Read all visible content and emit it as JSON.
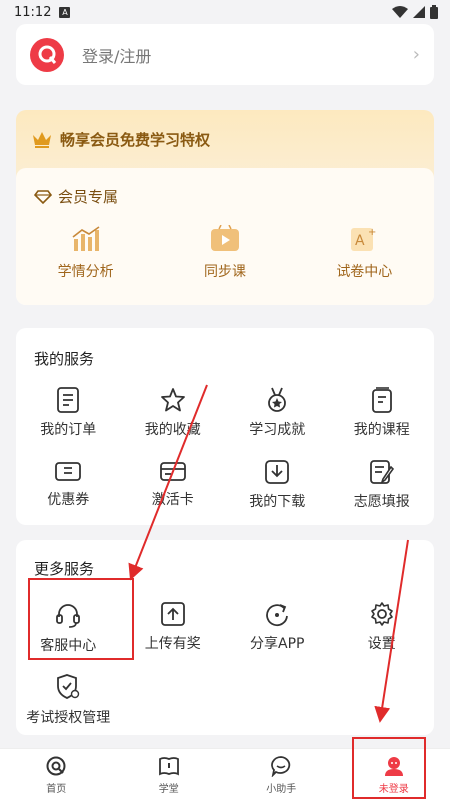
{
  "status_bar": {
    "time": "11:12",
    "notif_letter": "A"
  },
  "login": {
    "text": "登录/注册"
  },
  "vip": {
    "banner": "畅享会员免费学习特权",
    "section": "会员专属",
    "items": [
      {
        "label": "学情分析",
        "icon": "chart-icon"
      },
      {
        "label": "同步课",
        "icon": "video-icon"
      },
      {
        "label": "试卷中心",
        "icon": "exam-icon"
      }
    ]
  },
  "services": {
    "title": "我的服务",
    "items": [
      {
        "label": "我的订单",
        "icon": "order-icon"
      },
      {
        "label": "我的收藏",
        "icon": "star-icon"
      },
      {
        "label": "学习成就",
        "icon": "medal-icon"
      },
      {
        "label": "我的课程",
        "icon": "course-icon"
      },
      {
        "label": "优惠券",
        "icon": "coupon-icon"
      },
      {
        "label": "激活卡",
        "icon": "card-icon"
      },
      {
        "label": "我的下载",
        "icon": "download-icon"
      },
      {
        "label": "志愿填报",
        "icon": "form-icon"
      }
    ]
  },
  "more": {
    "title": "更多服务",
    "items": [
      {
        "label": "客服中心",
        "icon": "headset-icon"
      },
      {
        "label": "上传有奖",
        "icon": "upload-icon"
      },
      {
        "label": "分享APP",
        "icon": "share-icon"
      },
      {
        "label": "设置",
        "icon": "gear-icon"
      },
      {
        "label": "考试授权管理",
        "icon": "shield-icon"
      }
    ]
  },
  "tabs": [
    {
      "label": "首页",
      "icon": "home-icon"
    },
    {
      "label": "学堂",
      "icon": "book-icon"
    },
    {
      "label": "小助手",
      "icon": "chat-icon"
    },
    {
      "label": "未登录",
      "icon": "user-icon",
      "active": true
    }
  ],
  "colors": {
    "accent": "#ee3b46",
    "vip_gold": "#a0661c",
    "annotation_red": "#e02b2b"
  }
}
